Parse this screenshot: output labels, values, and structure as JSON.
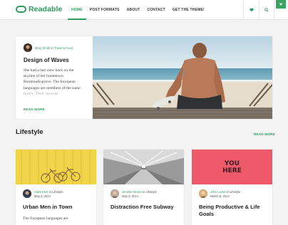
{
  "header": {
    "logo": "Readable",
    "nav": [
      "HOME",
      "POST FORMATS",
      "ABOUT",
      "CONTACT",
      "GET THE THEME!"
    ],
    "icons": {
      "heart": "heart-icon",
      "search": "search-icon",
      "dropdown": "chevron-down-icon"
    }
  },
  "featured": {
    "author": "Mary Smith",
    "in_text": "in",
    "category": "Travel & Food",
    "title": "Design of Waves",
    "excerpt": "She had a last view back on the skyline of her hometown Bookmarksgrove. The European languages are members of the same family. Their separate",
    "read_more": "READ MORE"
  },
  "section": {
    "title": "Lifestyle",
    "read_more": "READ MORE"
  },
  "cards": [
    {
      "author": "Clark Kent",
      "category": "Lifestyle",
      "date": "May 2, 2014",
      "title": "Urban Men in Town",
      "excerpt": "The European languages are"
    },
    {
      "author": "Jennifer Moore",
      "category": "Lifestyle",
      "date": "May 2, 2014",
      "title": "Distraction Free Subway",
      "excerpt": ""
    },
    {
      "author": "John Locke",
      "category": "Lifestyle",
      "date": "March 5, 2014",
      "title": "Being Productive & Life Goals",
      "excerpt": "",
      "image_text": "YOU HERE"
    }
  ],
  "colors": {
    "accent": "#2e9c5e",
    "background": "#f3f3f3"
  }
}
